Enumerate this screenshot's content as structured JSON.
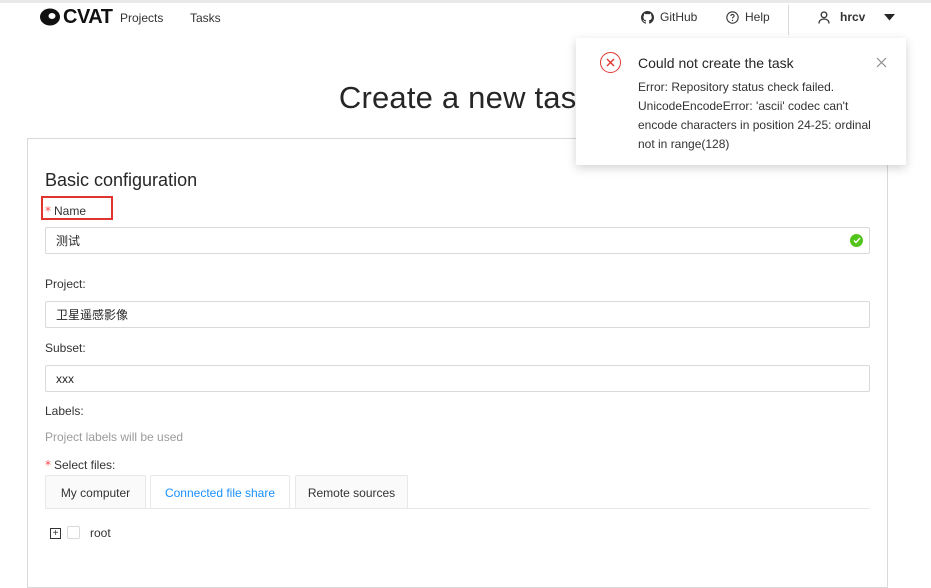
{
  "header": {
    "brand": "CVAT",
    "nav": {
      "projects": "Projects",
      "tasks": "Tasks"
    },
    "github": "GitHub",
    "help": "Help",
    "user": "hrcv"
  },
  "page": {
    "title": "Create a new task"
  },
  "form": {
    "section_title": "Basic configuration",
    "name": {
      "label": "Name",
      "value": "测试"
    },
    "project": {
      "label": "Project:",
      "value": "卫星遥感影像"
    },
    "subset": {
      "label": "Subset:",
      "value": "xxx"
    },
    "labels": {
      "label": "Labels:",
      "hint": "Project labels will be used"
    },
    "select_files": {
      "label": "Select files:",
      "tabs": [
        "My computer",
        "Connected file share",
        "Remote sources"
      ],
      "active_tab": "Connected file share",
      "tree": {
        "root": "root"
      }
    }
  },
  "notification": {
    "title": "Could not create the task",
    "description": "Error: Repository status check failed. UnicodeEncodeError: 'ascii' codec can't encode characters in position 24-25: ordinal not in range(128)"
  },
  "colors": {
    "accent": "#1890ff",
    "error": "#e0342f",
    "success": "#52c41a",
    "required": "#ff4d4f"
  }
}
